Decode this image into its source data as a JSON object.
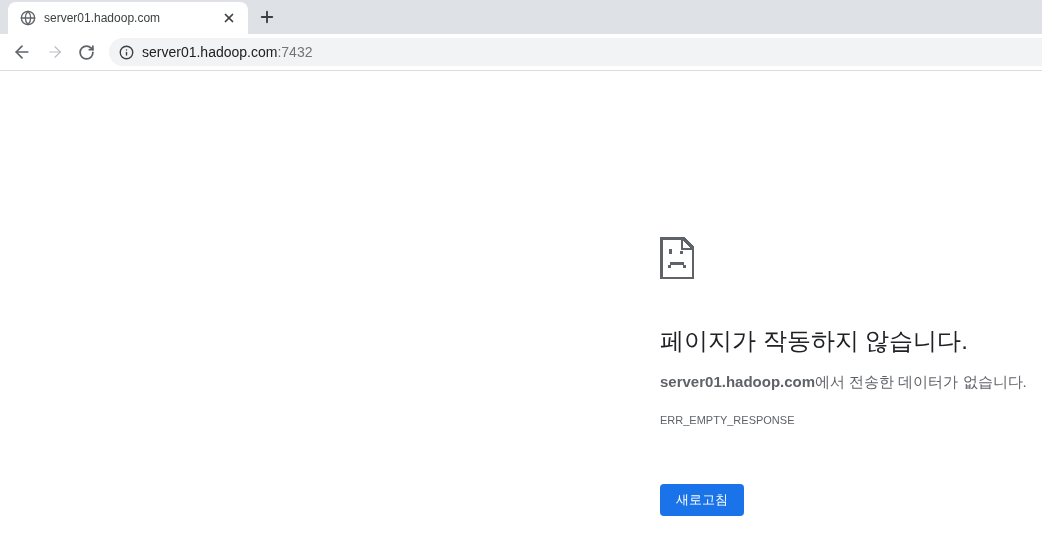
{
  "tab": {
    "title": "server01.hadoop.com",
    "selected": true
  },
  "address_bar": {
    "host": "server01.hadoop.com",
    "port": ":7432"
  },
  "navigation": {
    "forward_disabled": true
  },
  "error": {
    "heading": "페이지가 작동하지 않습니다.",
    "message": "**server01.hadoop.com**에서 전송한 데이터가 없습니다.",
    "code": "ERR_EMPTY_RESPONSE",
    "button": "새로고침"
  }
}
